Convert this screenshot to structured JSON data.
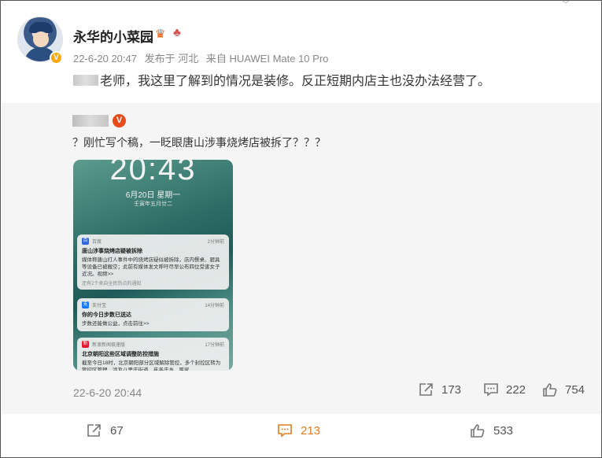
{
  "post": {
    "username": "永华的小菜园",
    "meta": {
      "date": "22-6-20 20:47",
      "published_in": "发布于 河北",
      "source": "来自 HUAWEI Mate 10 Pro"
    },
    "text": "老师，我这里了解到的情况是装修。反正短期内店主也没办法经营了。"
  },
  "repost": {
    "text": "？刚忙写个稿，一眨眼唐山涉事烧烤店被拆了？？？",
    "phone": {
      "time": "20:43",
      "date": "6月20日 星期一",
      "lunar": "壬寅年五月廿二",
      "notifications": [
        {
          "app": "百度",
          "time": "2分钟前",
          "title": "唐山涉事烧烤店疑被拆除",
          "body": "媒体称唐山打人事件中的烧烤店疑似被拆除，店内餐桌、厨具等设备已被搬空；此前有媒体发文呼吁尽早公布四位受害女子近况。视频>>",
          "more": "还有2个来自全民热点的通知"
        },
        {
          "app": "支付宝",
          "time": "14分钟前",
          "title": "你的今日步数已送达",
          "body": "步数还能做公益，点击前往>>"
        },
        {
          "app": "新浪新闻极速版",
          "time": "17分钟前",
          "title": "北京朝阳这些区域调整防控措施",
          "body": "截至今日18时，北京朝阳部分区域解除管控，多个封控区转为管控区管理，涉及八里庄街道、崔各庄乡、呼家"
        }
      ]
    },
    "timestamp": "22-6-20 20:44",
    "share_count": "173",
    "comment_count": "222",
    "like_count": "754"
  },
  "footer": {
    "share_count": "67",
    "comment_count": "213",
    "like_count": "533"
  },
  "colors": {
    "accent_orange": "#e07b1f",
    "verify_gold": "#f7a900",
    "verify_red": "#e64b19"
  }
}
